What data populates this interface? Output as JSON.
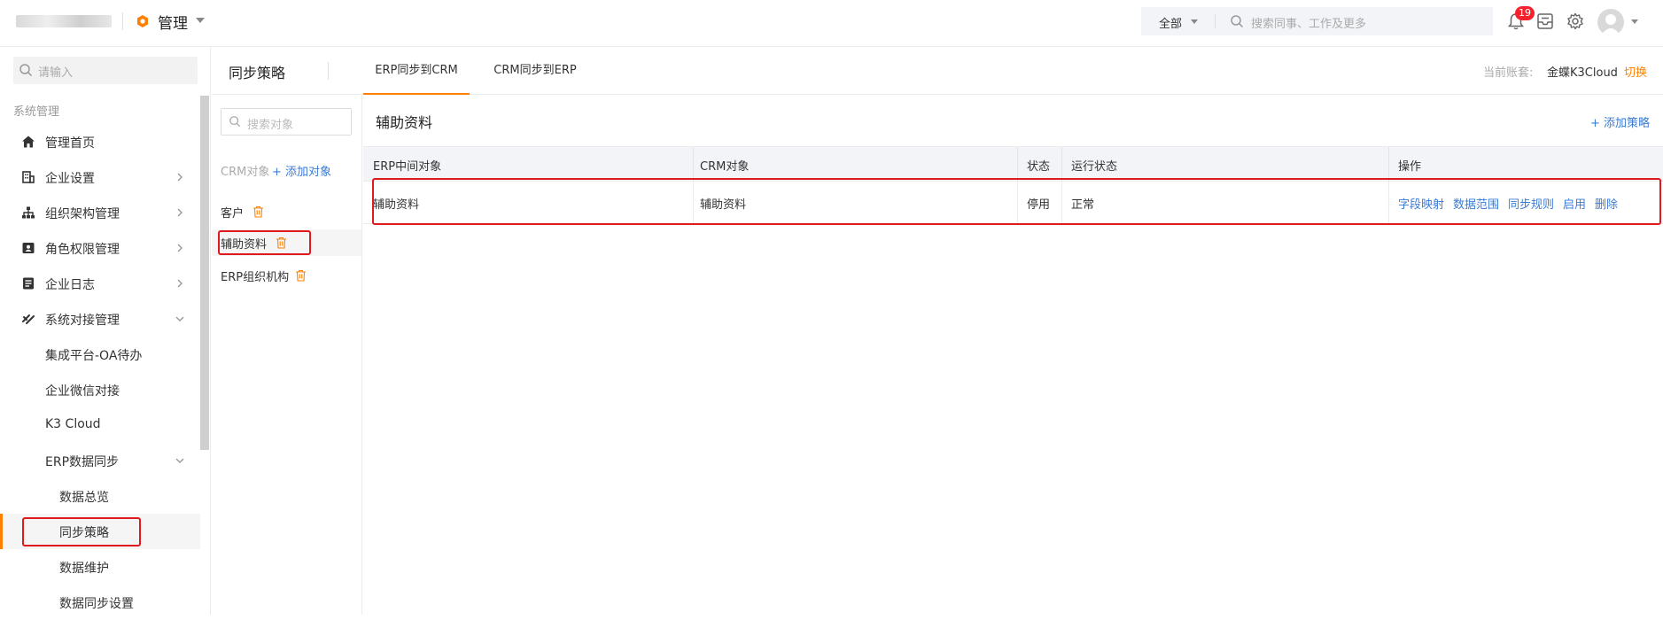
{
  "topbar": {
    "app_name": "管理",
    "search_scope": "全部",
    "search_placeholder": "搜索同事、工作及更多",
    "notification_count": "19",
    "icons": [
      "bell-icon",
      "inbox-icon",
      "gear-icon",
      "avatar"
    ]
  },
  "sidebar": {
    "search_placeholder": "请输入",
    "section_title": "系统管理",
    "items": [
      {
        "label": "管理首页",
        "icon": "home-icon"
      },
      {
        "label": "企业设置",
        "icon": "building-icon"
      },
      {
        "label": "组织架构管理",
        "icon": "org-tree-icon"
      },
      {
        "label": "角色权限管理",
        "icon": "id-card-icon"
      },
      {
        "label": "企业日志",
        "icon": "log-icon"
      },
      {
        "label": "系统对接管理",
        "icon": "link-icon"
      },
      {
        "label": "集成平台-OA待办"
      },
      {
        "label": "企业微信对接"
      },
      {
        "label": "K3 Cloud"
      },
      {
        "label": "ERP数据同步"
      },
      {
        "label": "数据总览"
      },
      {
        "label": "同步策略"
      },
      {
        "label": "数据维护"
      },
      {
        "label": "数据同步设置"
      }
    ]
  },
  "header": {
    "page_title": "同步策略",
    "tabs": [
      {
        "label": "ERP同步到CRM"
      },
      {
        "label": "CRM同步到ERP"
      }
    ],
    "account_label": "当前账套:",
    "account_value": "金蝶K3Cloud",
    "switch_label": "切换"
  },
  "objects": {
    "search_placeholder": "搜索对象",
    "title": "CRM对象",
    "add_label": "+ 添加对象",
    "items": [
      {
        "label": "客户"
      },
      {
        "label": "辅助资料"
      },
      {
        "label": "ERP组织机构"
      }
    ]
  },
  "main": {
    "title": "辅助资料",
    "add_policy_label": "+ 添加策略",
    "table": {
      "headers": [
        "ERP中间对象",
        "CRM对象",
        "状态",
        "运行状态",
        "操作"
      ],
      "rows": [
        {
          "erp_object": "辅助资料",
          "crm_object": "辅助资料",
          "status": "停用",
          "run_status": "正常",
          "actions": [
            "字段映射",
            "数据范围",
            "同步规则",
            "启用",
            "删除"
          ]
        }
      ]
    }
  },
  "colors": {
    "accent": "#ff8000",
    "link": "#3a7bd5",
    "annotation": "#e0191c",
    "badge": "#f5222d"
  }
}
